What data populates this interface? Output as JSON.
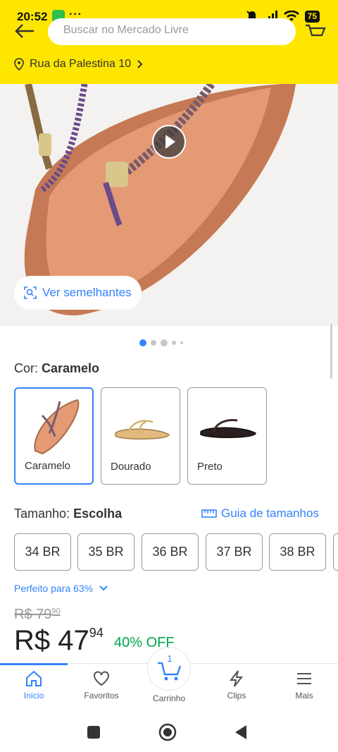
{
  "status_bar": {
    "time": "20:52",
    "more": "···",
    "battery": "75"
  },
  "header": {
    "search_placeholder": "Buscar no Mercado Livre",
    "address": "Rua da Palestina 10"
  },
  "product": {
    "similar_button": "Ver semelhantes",
    "pager": {
      "count": 5,
      "active": 0
    },
    "color": {
      "label": "Cor: ",
      "value": "Caramelo"
    },
    "variants": [
      {
        "label": "Caramelo",
        "selected": true
      },
      {
        "label": "Dourado",
        "selected": false
      },
      {
        "label": "Preto",
        "selected": false
      }
    ],
    "size": {
      "label": "Tamanho: ",
      "value": "Escolha",
      "guide": "Guia de tamanhos"
    },
    "sizes": [
      "34 BR",
      "35 BR",
      "36 BR",
      "37 BR",
      "38 BR"
    ],
    "fit_text": "Perfeito para 63%",
    "price": {
      "old_currency": "R$ 79",
      "old_cents": "90",
      "currency": "R$ 47",
      "cents": "94",
      "discount": "40% OFF"
    }
  },
  "bottom_nav": {
    "items": [
      {
        "label": "Início",
        "icon": "home-icon",
        "active": true
      },
      {
        "label": "Favoritos",
        "icon": "heart-icon",
        "active": false
      },
      {
        "label": "Carrinho",
        "icon": "cart-icon",
        "active": false,
        "count": "1"
      },
      {
        "label": "Clips",
        "icon": "lightning-icon",
        "active": false
      },
      {
        "label": "Mais",
        "icon": "menu-icon",
        "active": false
      }
    ]
  },
  "colors": {
    "header": "#FFE600",
    "accent": "#3483FA",
    "discount": "#00A650"
  }
}
